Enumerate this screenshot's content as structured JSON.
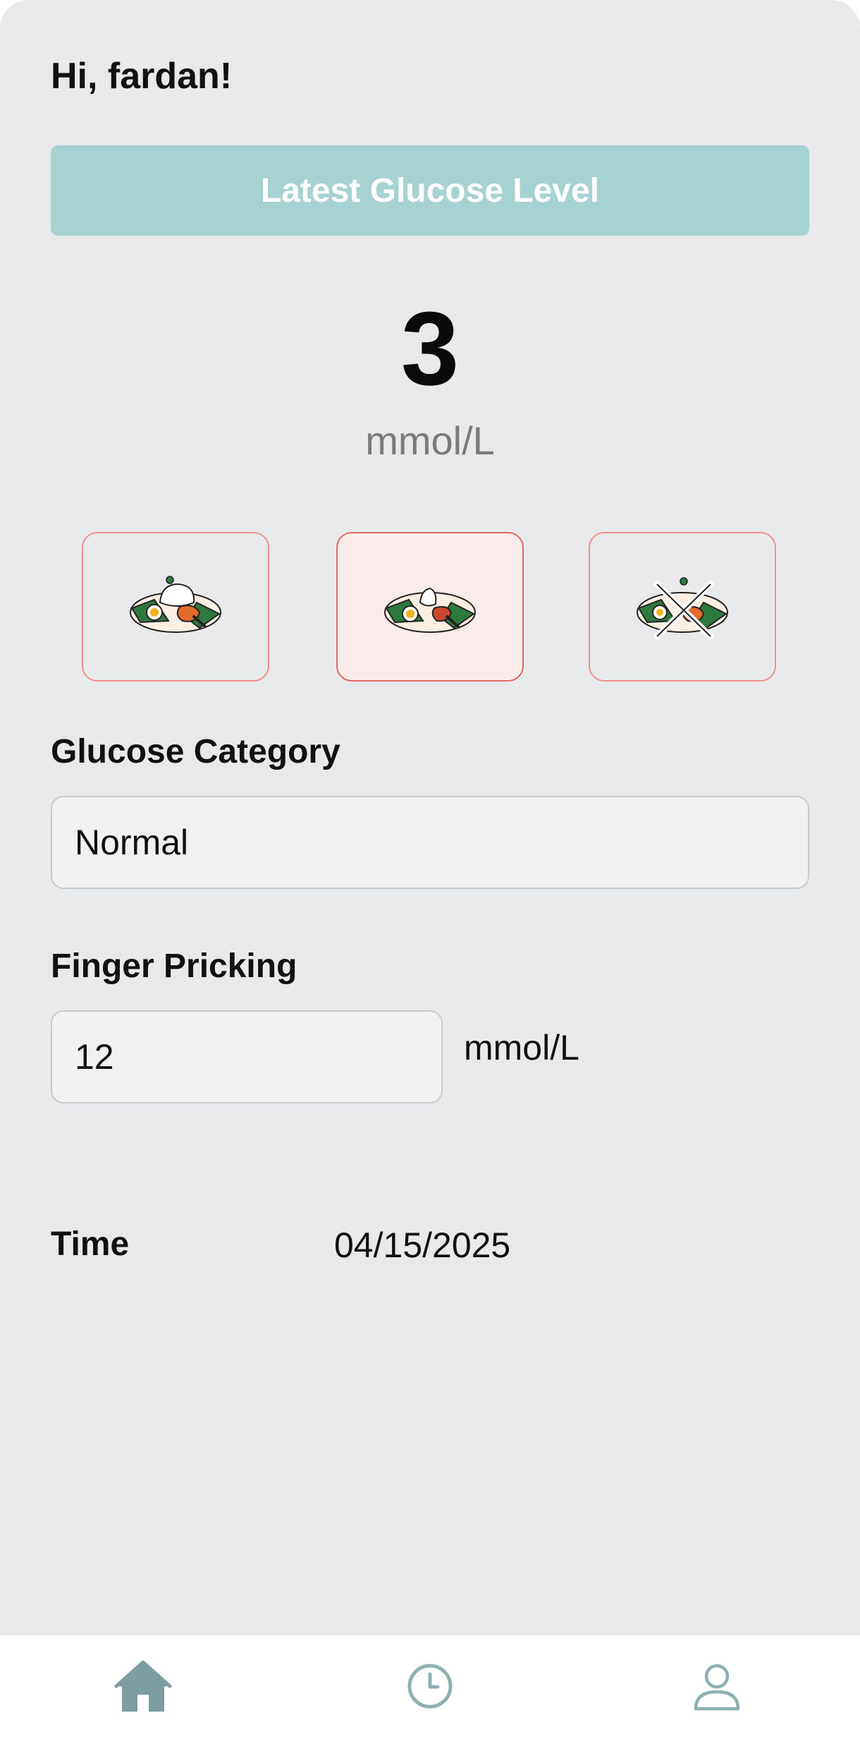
{
  "greeting": "Hi, fardan!",
  "latest_banner": "Latest Glucose Level",
  "glucose": {
    "value": "3",
    "unit": "mmol/L"
  },
  "meal_options": [
    {
      "icon": "meal-plate-before-icon",
      "selected": false
    },
    {
      "icon": "meal-plate-after-icon",
      "selected": true
    },
    {
      "icon": "meal-plate-none-icon",
      "selected": false
    }
  ],
  "glucose_category": {
    "label": "Glucose Category",
    "value": "Normal"
  },
  "finger_pricking": {
    "label": "Finger Pricking",
    "value": "12",
    "unit": "mmol/L"
  },
  "time": {
    "label": "Time",
    "value": "04/15/2025"
  },
  "nav": [
    {
      "icon": "home-icon",
      "active": true
    },
    {
      "icon": "history-icon",
      "active": false
    },
    {
      "icon": "profile-icon",
      "active": false
    }
  ],
  "colors": {
    "background": "#e8e9eb",
    "banner": "#a7d2d2",
    "card_border": "#f0908e",
    "card_selected_bg": "#fbecec",
    "nav_active": "#7d9ea0",
    "nav_inactive": "#8fb0b2"
  }
}
